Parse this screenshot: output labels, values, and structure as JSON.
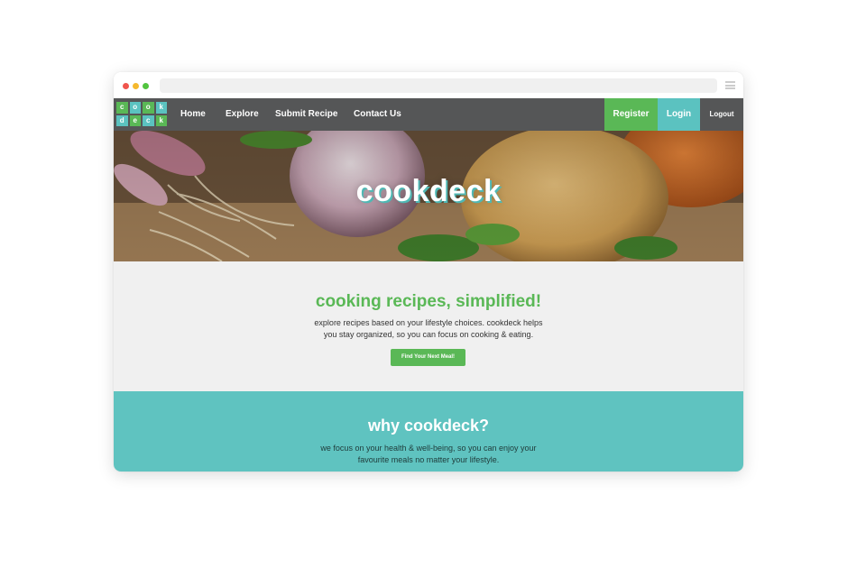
{
  "nav": {
    "logo_letters": [
      "c",
      "o",
      "o",
      "k",
      "d",
      "e",
      "c",
      "k"
    ],
    "links": [
      "Home",
      "Explore",
      "Submit Recipe",
      "Contact Us"
    ],
    "register": "Register",
    "login": "Login",
    "logout": "Logout"
  },
  "hero": {
    "title": "cookdeck"
  },
  "intro": {
    "title": "cooking recipes, simplified!",
    "text_line1": "explore recipes based on your lifestyle choices. cookdeck helps",
    "text_line2": "you stay organized, so you can focus on cooking & eating.",
    "cta": "Find Your Next Meal!"
  },
  "why": {
    "title": "why cookdeck?",
    "text_line1": "we focus on your health & well-being, so you can enjoy your",
    "text_line2": "favourite meals no matter your lifestyle."
  },
  "colors": {
    "nav_bg": "#555657",
    "brand_green": "#5ab856",
    "brand_teal": "#5bc2c0",
    "intro_bg": "#f0f0f0"
  }
}
